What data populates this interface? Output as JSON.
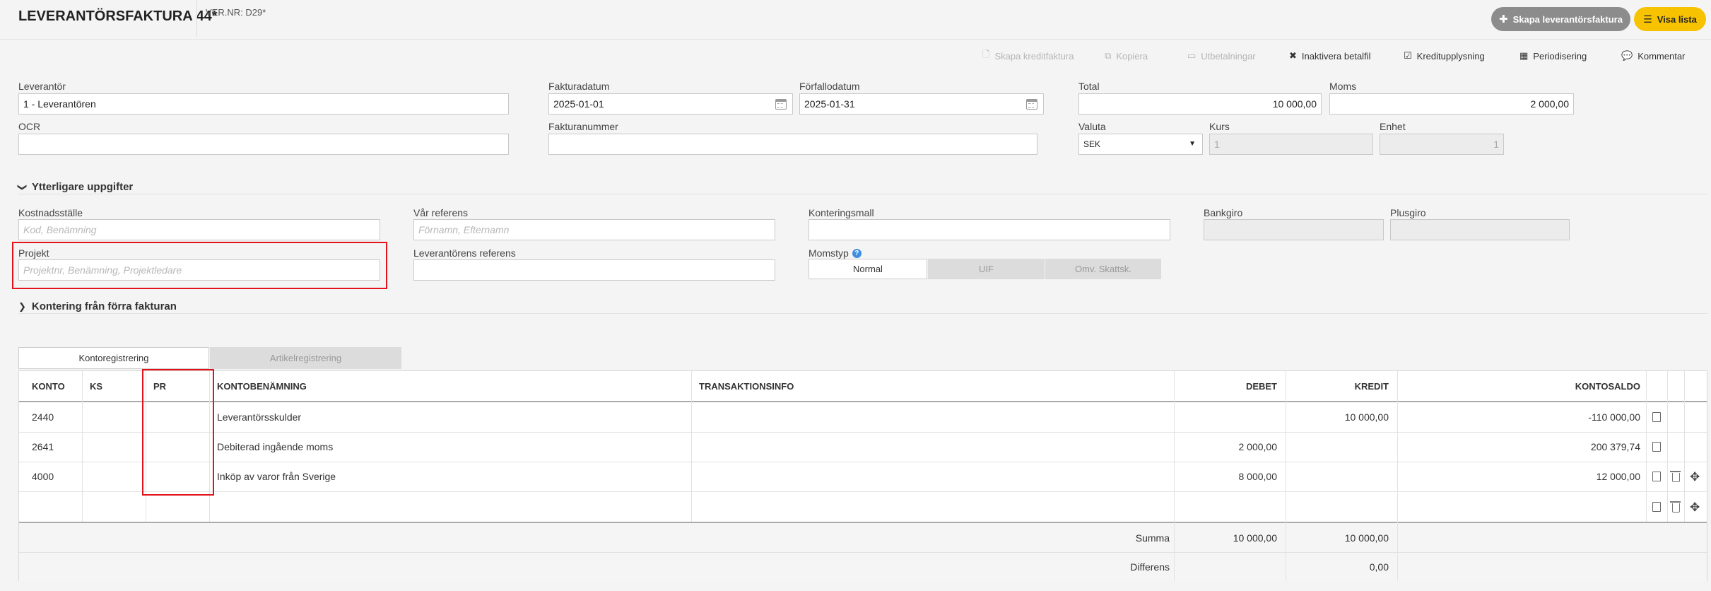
{
  "header": {
    "title": "LEVERANTÖRSFAKTURA 44*",
    "vernr": "VER.NR: D29*",
    "btn_create": "Skapa leverantörsfaktura",
    "btn_list": "Visa lista"
  },
  "toolbar": {
    "credit": "Skapa kreditfaktura",
    "copy": "Kopiera",
    "payments": "Utbetalningar",
    "deactivate": "Inaktivera betalfil",
    "credit_info": "Kreditupplysning",
    "periodize": "Periodisering",
    "comment": "Kommentar"
  },
  "form": {
    "supplier": {
      "label": "Leverantör",
      "value": "1 - Leverantören"
    },
    "invoice_date": {
      "label": "Fakturadatum",
      "value": "2025-01-01"
    },
    "due_date": {
      "label": "Förfallodatum",
      "value": "2025-01-31"
    },
    "total": {
      "label": "Total",
      "value": "10 000,00"
    },
    "vat": {
      "label": "Moms",
      "value": "2 000,00"
    },
    "ocr": {
      "label": "OCR",
      "value": ""
    },
    "invoice_number": {
      "label": "Fakturanummer",
      "value": ""
    },
    "currency": {
      "label": "Valuta",
      "value": "SEK"
    },
    "rate": {
      "label": "Kurs",
      "value": "1"
    },
    "unit": {
      "label": "Enhet",
      "value": "1"
    }
  },
  "extra": {
    "title": "Ytterligare uppgifter",
    "cost_center": {
      "label": "Kostnadsställe",
      "placeholder": "Kod, Benämning"
    },
    "our_ref": {
      "label": "Vår referens",
      "placeholder": "Förnamn, Efternamn"
    },
    "template": {
      "label": "Konteringsmall",
      "value": ""
    },
    "bankgiro": {
      "label": "Bankgiro",
      "value": ""
    },
    "plusgiro": {
      "label": "Plusgiro",
      "value": ""
    },
    "project": {
      "label": "Projekt",
      "placeholder": "Projektnr, Benämning, Projektledare"
    },
    "supplier_ref": {
      "label": "Leverantörens referens",
      "value": ""
    },
    "vat_type": {
      "label": "Momstyp",
      "options": [
        "Normal",
        "UIF",
        "Omv. Skattsk."
      ],
      "selected": "Normal"
    }
  },
  "prev": {
    "title": "Kontering från förra fakturan"
  },
  "tabs": [
    "Kontoregistrering",
    "Artikelregistrering"
  ],
  "table": {
    "headers": [
      "KONTO",
      "KS",
      "PR",
      "KONTOBENÄMNING",
      "TRANSAKTIONSINFO",
      "DEBET",
      "KREDIT",
      "KONTOSALDO"
    ],
    "rows": [
      {
        "konto": "2440",
        "ks": "",
        "pr": "",
        "name": "Leverantörsskulder",
        "info": "",
        "debet": "",
        "kredit": "10 000,00",
        "saldo": "-110 000,00"
      },
      {
        "konto": "2641",
        "ks": "",
        "pr": "",
        "name": "Debiterad ingående moms",
        "info": "",
        "debet": "2 000,00",
        "kredit": "",
        "saldo": "200 379,74"
      },
      {
        "konto": "4000",
        "ks": "",
        "pr": "",
        "name": "Inköp av varor från Sverige",
        "info": "",
        "debet": "8 000,00",
        "kredit": "",
        "saldo": "12 000,00"
      }
    ],
    "sum_label": "Summa",
    "sum_debet": "10 000,00",
    "sum_kredit": "10 000,00",
    "diff_label": "Differens",
    "diff_value": "0,00"
  }
}
